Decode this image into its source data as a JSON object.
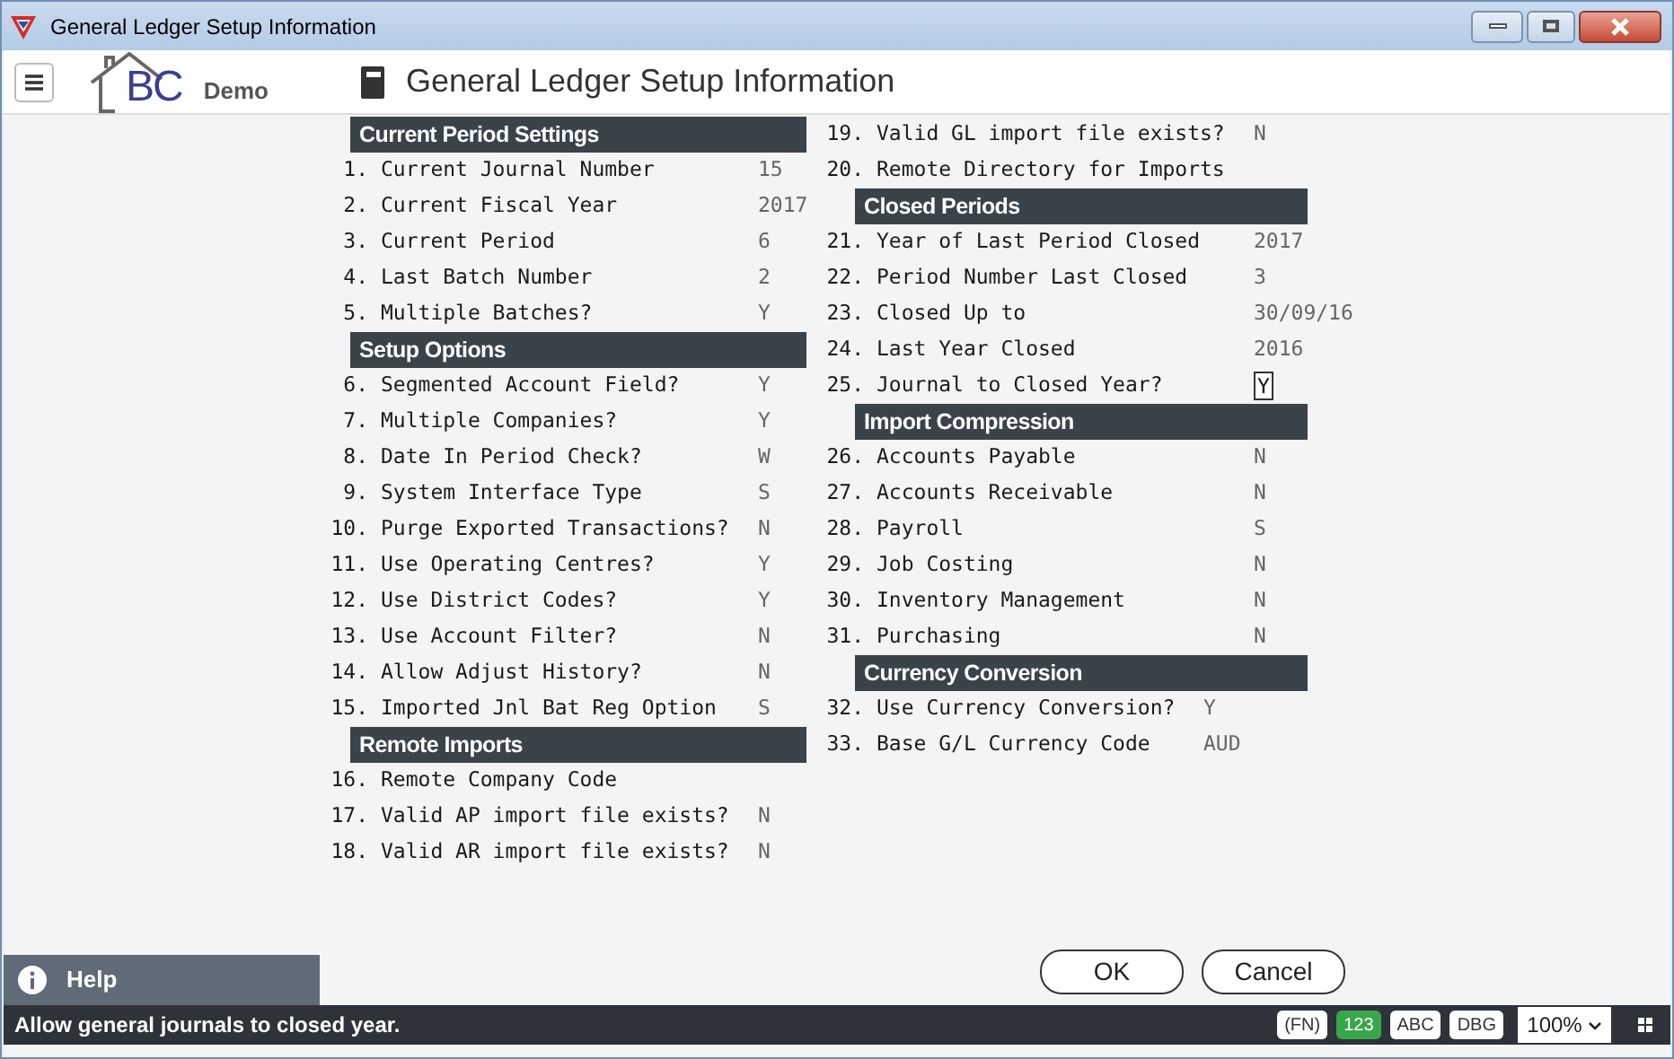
{
  "window": {
    "title": "General Ledger Setup Information"
  },
  "header": {
    "logo_text": "BC",
    "logo_subtitle": "Demo",
    "title": "General Ledger Setup Information"
  },
  "columns": [
    {
      "sections": [
        {
          "heading": "Current Period Settings",
          "fields": [
            {
              "number": "1.",
              "label": "Current Journal Number",
              "value": "15"
            },
            {
              "number": "2.",
              "label": "Current Fiscal Year",
              "value": "2017"
            },
            {
              "number": "3.",
              "label": "Current Period",
              "value": "6"
            },
            {
              "number": "4.",
              "label": "Last Batch Number",
              "value": "2"
            },
            {
              "number": "5.",
              "label": "Multiple Batches?",
              "value": "Y"
            }
          ]
        },
        {
          "heading": "Setup Options",
          "fields": [
            {
              "number": "6.",
              "label": "Segmented Account Field?",
              "value": "Y"
            },
            {
              "number": "7.",
              "label": "Multiple Companies?",
              "value": "Y"
            },
            {
              "number": "8.",
              "label": "Date In Period Check?",
              "value": "W"
            },
            {
              "number": "9.",
              "label": "System Interface Type",
              "value": "S"
            },
            {
              "number": "10.",
              "label": "Purge Exported Transactions?",
              "value": "N"
            },
            {
              "number": "11.",
              "label": "Use Operating Centres?",
              "value": "Y"
            },
            {
              "number": "12.",
              "label": "Use District Codes?",
              "value": "Y"
            },
            {
              "number": "13.",
              "label": "Use Account Filter?",
              "value": "N"
            },
            {
              "number": "14.",
              "label": "Allow Adjust History?",
              "value": "N"
            },
            {
              "number": "15.",
              "label": "Imported Jnl Bat Reg Option",
              "value": "S"
            }
          ]
        },
        {
          "heading": "Remote Imports",
          "fields": [
            {
              "number": "16.",
              "label": "Remote Company Code"
            },
            {
              "number": "17.",
              "label": "Valid AP import file exists?",
              "value": "N"
            },
            {
              "number": "18.",
              "label": "Valid AR import file exists?",
              "value": "N"
            }
          ]
        }
      ]
    },
    {
      "sections": [
        {
          "fields": [
            {
              "number": "19.",
              "label": "Valid GL import file exists?",
              "value": "N"
            },
            {
              "number": "20.",
              "label": "Remote Directory for Imports"
            }
          ]
        },
        {
          "heading": "Closed Periods",
          "fields": [
            {
              "number": "21.",
              "label": "Year of Last Period Closed",
              "value": "2017"
            },
            {
              "number": "22.",
              "label": "Period Number Last Closed",
              "value": "3"
            },
            {
              "number": "23.",
              "label": "Closed Up to",
              "value": "30/09/16"
            },
            {
              "number": "24.",
              "label": "Last Year Closed",
              "value": "2016"
            },
            {
              "number": "25.",
              "label": "Journal to Closed Year?",
              "value": "Y",
              "focused": true
            }
          ]
        },
        {
          "heading": "Import Compression",
          "fields": [
            {
              "number": "26.",
              "label": "Accounts Payable",
              "value": "N"
            },
            {
              "number": "27.",
              "label": "Accounts Receivable",
              "value": "N"
            },
            {
              "number": "28.",
              "label": "Payroll",
              "value": "S"
            },
            {
              "number": "29.",
              "label": "Job Costing",
              "value": "N"
            },
            {
              "number": "30.",
              "label": "Inventory Management",
              "value": "N"
            },
            {
              "number": "31.",
              "label": "Purchasing",
              "value": "N"
            }
          ]
        },
        {
          "heading": "Currency Conversion",
          "fields": [
            {
              "number": "32.",
              "label": "Use Currency Conversion?",
              "value": "Y"
            },
            {
              "number": "33.",
              "label": "Base G/L Currency Code",
              "value": "AUD"
            }
          ]
        }
      ]
    }
  ],
  "help": {
    "label": "Help"
  },
  "buttons": [
    {
      "label": "OK"
    },
    {
      "label": "Cancel"
    }
  ],
  "status_bar": {
    "message": "Allow general journals to closed year.",
    "indicators": [
      {
        "label": "(FN)",
        "on": false
      },
      {
        "label": "123",
        "on": true
      },
      {
        "label": "ABC",
        "on": false
      },
      {
        "label": "DBG",
        "on": false
      }
    ],
    "zoom": "100%"
  }
}
